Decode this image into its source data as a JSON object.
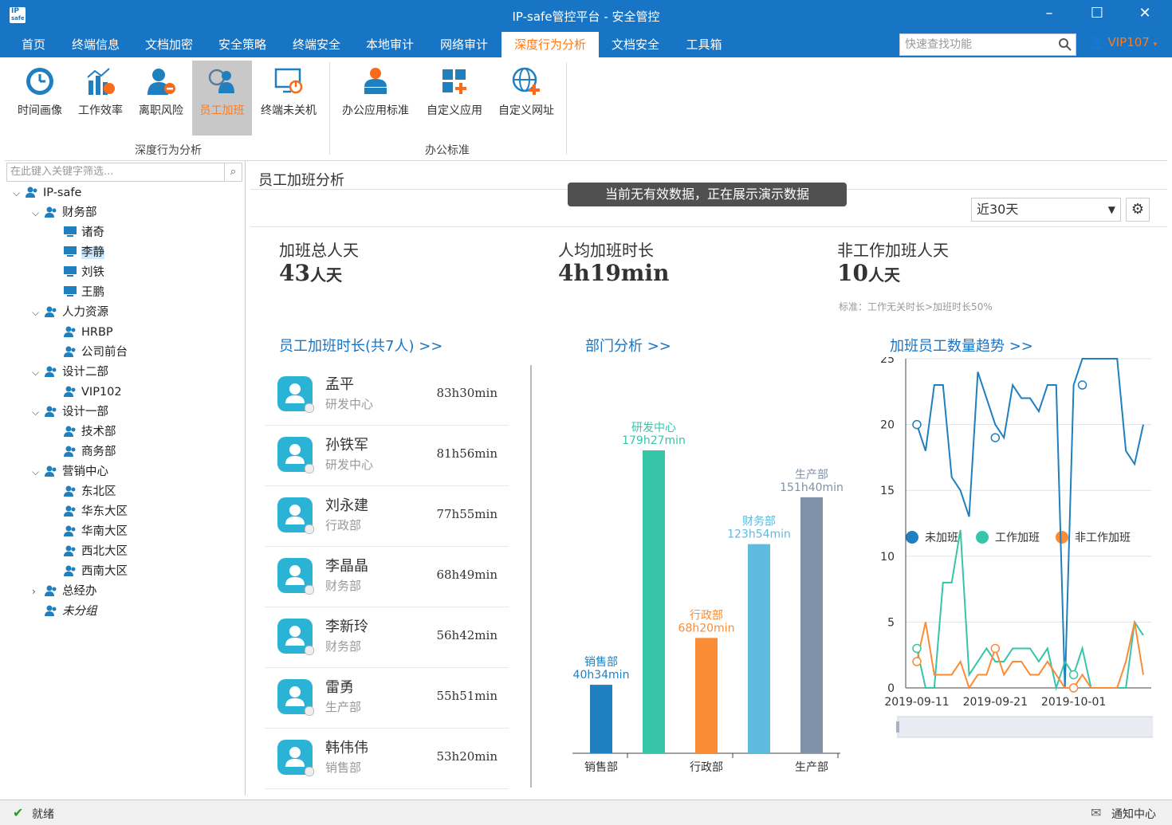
{
  "window": {
    "title": "IP-safe管控平台 - 安全管控",
    "logo_text": "IP safe"
  },
  "menu": {
    "items": [
      "首页",
      "终端信息",
      "文档加密",
      "安全策略",
      "终端安全",
      "本地审计",
      "网络审计",
      "深度行为分析",
      "文档安全",
      "工具箱"
    ],
    "active_index": 7,
    "search_placeholder": "快速查找功能",
    "user": "VIP107"
  },
  "ribbon": {
    "buttons": [
      {
        "label": "时间画像",
        "icon": "clock-icon"
      },
      {
        "label": "工作效率",
        "icon": "efficiency-chart-icon"
      },
      {
        "label": "离职风险",
        "icon": "user-risk-icon"
      },
      {
        "label": "员工加班",
        "icon": "overtime-users-icon",
        "selected": true
      },
      {
        "label": "终端未关机",
        "icon": "monitor-power-icon"
      },
      {
        "label": "办公应用标准",
        "icon": "office-user-icon"
      },
      {
        "label": "自定义应用",
        "icon": "app-grid-add-icon"
      },
      {
        "label": "自定义网址",
        "icon": "globe-add-icon"
      }
    ],
    "groups": [
      "深度行为分析",
      "办公标准"
    ]
  },
  "tree": {
    "filter_placeholder": "在此键入关键字筛选...",
    "nodes": [
      {
        "label": "IP-safe",
        "level": 0,
        "type": "group",
        "expand": "v"
      },
      {
        "label": "财务部",
        "level": 1,
        "type": "group",
        "expand": "v"
      },
      {
        "label": "诸奇",
        "level": 2,
        "type": "pc"
      },
      {
        "label": "李静",
        "level": 2,
        "type": "pc",
        "selected": true
      },
      {
        "label": "刘铁",
        "level": 2,
        "type": "pc"
      },
      {
        "label": "王鹏",
        "level": 2,
        "type": "pc"
      },
      {
        "label": "人力资源",
        "level": 1,
        "type": "group",
        "expand": "v"
      },
      {
        "label": "HRBP",
        "level": 2,
        "type": "group"
      },
      {
        "label": "公司前台",
        "level": 2,
        "type": "group"
      },
      {
        "label": "设计二部",
        "level": 1,
        "type": "group",
        "expand": "v"
      },
      {
        "label": "VIP102",
        "level": 2,
        "type": "group"
      },
      {
        "label": "设计一部",
        "level": 1,
        "type": "group",
        "expand": "v"
      },
      {
        "label": "技术部",
        "level": 2,
        "type": "group"
      },
      {
        "label": "商务部",
        "level": 2,
        "type": "group"
      },
      {
        "label": "营销中心",
        "level": 1,
        "type": "group",
        "expand": "v"
      },
      {
        "label": "东北区",
        "level": 2,
        "type": "group"
      },
      {
        "label": "华东大区",
        "level": 2,
        "type": "group"
      },
      {
        "label": "华南大区",
        "level": 2,
        "type": "group"
      },
      {
        "label": "西北大区",
        "level": 2,
        "type": "group"
      },
      {
        "label": "西南大区",
        "level": 2,
        "type": "group"
      },
      {
        "label": "总经办",
        "level": 1,
        "type": "group",
        "expand": ">"
      },
      {
        "label": "未分组",
        "level": 1,
        "type": "group",
        "italic": true
      }
    ]
  },
  "page": {
    "title": "员工加班分析",
    "demo_notice": "当前无有效数据，正在展示演示数据",
    "period": "近30天"
  },
  "stats": [
    {
      "label": "加班总人天",
      "value": "43",
      "unit": "人天"
    },
    {
      "label": "人均加班时长",
      "value": "4h19min",
      "unit": ""
    },
    {
      "label": "非工作加班人天",
      "value": "10",
      "unit": "人天"
    }
  ],
  "stats_note": "标准：工作无关时长>加班时长50%",
  "sections": {
    "employees": "员工加班时长(共7人) >>",
    "departments": "部门分析 >>",
    "trend": "加班员工数量趋势 >>"
  },
  "employees": [
    {
      "name": "孟平",
      "dept": "研发中心",
      "time": "83h30min"
    },
    {
      "name": "孙铁军",
      "dept": "研发中心",
      "time": "81h56min"
    },
    {
      "name": "刘永建",
      "dept": "行政部",
      "time": "77h55min"
    },
    {
      "name": "李晶晶",
      "dept": "财务部",
      "time": "68h49min"
    },
    {
      "name": "李新玲",
      "dept": "财务部",
      "time": "56h42min"
    },
    {
      "name": "雷勇",
      "dept": "生产部",
      "time": "55h51min"
    },
    {
      "name": "韩伟伟",
      "dept": "销售部",
      "time": "53h20min"
    }
  ],
  "chart_data": [
    {
      "type": "bar",
      "categories": [
        "销售部",
        "研发中心",
        "行政部",
        "财务部",
        "生产部"
      ],
      "x_tick_labels": [
        "销售部",
        "行政部",
        "生产部"
      ],
      "values": [
        40.57,
        179.45,
        68.33,
        123.9,
        151.67
      ],
      "data_labels": [
        [
          "销售部",
          "40h34min"
        ],
        [
          "研发中心",
          "179h27min"
        ],
        [
          "行政部",
          "68h20min"
        ],
        [
          "财务部",
          "123h54min"
        ],
        [
          "生产部",
          "151h40min"
        ]
      ],
      "colors": [
        "#1f7fbf",
        "#36c5a8",
        "#fa8c35",
        "#5ebadf",
        "#7f92a8"
      ]
    },
    {
      "type": "line",
      "x_tick_labels": [
        "2019-09-11",
        "2019-09-21",
        "2019-10-01"
      ],
      "ylim": [
        0,
        25
      ],
      "yticks": [
        0,
        5,
        10,
        15,
        20,
        25
      ],
      "legend": "top",
      "series": [
        {
          "name": "未加班",
          "color": "#1f7fbf",
          "values": [
            20,
            18,
            23,
            23,
            16,
            15,
            13,
            24,
            22,
            20,
            19,
            23,
            22,
            22,
            21,
            23,
            23,
            0,
            23,
            25,
            25,
            25,
            25,
            25,
            18,
            17,
            20
          ]
        },
        {
          "name": "工作加班",
          "color": "#36c5a8",
          "values": [
            3,
            0,
            0,
            8,
            8,
            12,
            1,
            2,
            3,
            2,
            2,
            3,
            3,
            3,
            2,
            3,
            0,
            2,
            1,
            3,
            0,
            0,
            0,
            0,
            0,
            5,
            4
          ]
        },
        {
          "name": "非工作加班",
          "color": "#fa8c35",
          "values": [
            2,
            5,
            1,
            1,
            1,
            2,
            0,
            1,
            1,
            3,
            1,
            2,
            2,
            1,
            1,
            2,
            1,
            0,
            0,
            1,
            0,
            0,
            0,
            0,
            2,
            5,
            1
          ]
        }
      ],
      "markers": [
        [
          0,
          20
        ],
        [
          9,
          19
        ],
        [
          19,
          23
        ],
        [
          0,
          3
        ],
        [
          0,
          2
        ],
        [
          9,
          3
        ],
        [
          18,
          1
        ],
        [
          18,
          0
        ]
      ]
    }
  ],
  "status": {
    "text": "就绪",
    "notify": "通知中心"
  }
}
